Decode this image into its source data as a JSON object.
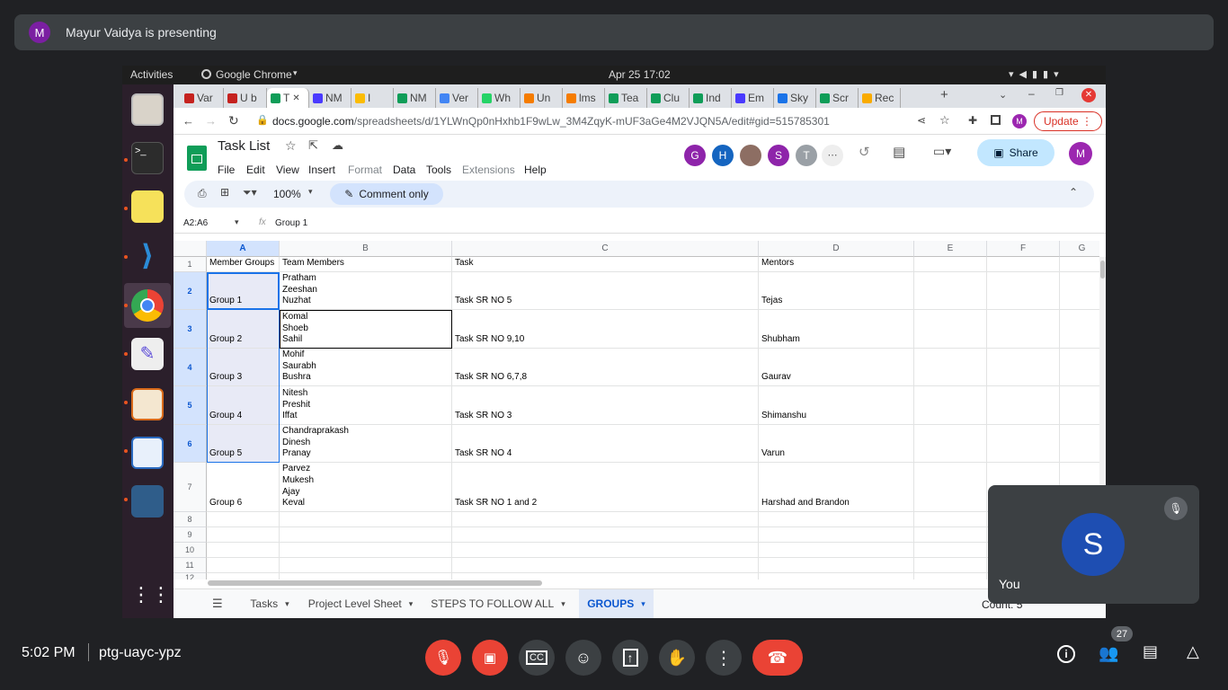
{
  "meet": {
    "presenter_initial": "M",
    "presenting_text": "Mayur Vaidya is presenting",
    "time": "5:02 PM",
    "meeting_code": "ptg-uayc-ypz",
    "participant_count": "27",
    "self_initial": "S",
    "self_label": "You"
  },
  "desktop": {
    "activities": "Activities",
    "app_name": "Google Chrome",
    "clock": "Apr 25  17:02"
  },
  "browser": {
    "tabs": [
      {
        "label": "Var",
        "color": "#c5221f"
      },
      {
        "label": "U b",
        "color": "#c5221f"
      },
      {
        "label": "T",
        "color": "#0f9d58",
        "active": true
      },
      {
        "label": "NM",
        "color": "#4a3aff"
      },
      {
        "label": "I",
        "color": "#fbbc04"
      },
      {
        "label": "NM",
        "color": "#0f9d58"
      },
      {
        "label": "Ver",
        "color": "#4285f4"
      },
      {
        "label": "Wh",
        "color": "#25d366"
      },
      {
        "label": "Un",
        "color": "#f57c00"
      },
      {
        "label": "lms",
        "color": "#f57c00"
      },
      {
        "label": "Tea",
        "color": "#0f9d58"
      },
      {
        "label": "Clu",
        "color": "#0f9d58"
      },
      {
        "label": "Ind",
        "color": "#0f9d58"
      },
      {
        "label": "Em",
        "color": "#4a3aff"
      },
      {
        "label": "Sky",
        "color": "#1a73e8"
      },
      {
        "label": "Scr",
        "color": "#0f9d58"
      },
      {
        "label": "Rec",
        "color": "#f9ab00"
      }
    ],
    "url_host": "docs.google.com",
    "url_path": "/spreadsheets/d/1YLWnQp0nHxhb1F9wLw_3M4ZqyK-mUF3aGe4M2VJQN5A/edit#gid=515785301",
    "update_label": "Update",
    "profile_initial": "M"
  },
  "sheets": {
    "doc_title": "Task List",
    "menus": [
      "File",
      "Edit",
      "View",
      "Insert",
      "Format",
      "Data",
      "Tools",
      "Extensions",
      "Help"
    ],
    "dim_menus": [
      "Format",
      "Extensions"
    ],
    "collaborators": [
      {
        "initial": "G",
        "color": "#8e24aa"
      },
      {
        "initial": "H",
        "color": "#1565c0"
      },
      {
        "initial": "",
        "color": "#8d6e63"
      },
      {
        "initial": "S",
        "color": "#8e24aa"
      },
      {
        "initial": "T",
        "color": "#9aa0a6"
      }
    ],
    "share_label": "Share",
    "account_initial": "M",
    "zoom": "100%",
    "mode_label": "Comment only",
    "name_box": "A2:A6",
    "formula": "Group 1",
    "columns": [
      "A",
      "B",
      "C",
      "D",
      "E",
      "F",
      "G"
    ],
    "rows": [
      {
        "num": "1",
        "cells": [
          "Member Groups",
          "Team Members",
          "Task",
          "Mentors"
        ]
      },
      {
        "num": "2",
        "cells": [
          "Group 1",
          "Pratham\nZeeshan\nNuzhat",
          "Task   SR NO 5",
          "Tejas"
        ]
      },
      {
        "num": "3",
        "cells": [
          "Group 2",
          "Komal\nShoeb\nSahil",
          "Task   SR NO 9,10",
          "Shubham"
        ]
      },
      {
        "num": "4",
        "cells": [
          "Group 3",
          "Mohif\nSaurabh\nBushra",
          "Task   SR NO 6,7,8",
          "Gaurav"
        ]
      },
      {
        "num": "5",
        "cells": [
          "Group 4",
          "Nitesh\nPreshit\nIffat",
          "Task   SR NO 3",
          "Shimanshu"
        ]
      },
      {
        "num": "6",
        "cells": [
          "Group 5",
          "Chandraprakash\nDinesh\nPranay",
          "Task   SR NO 4",
          "Varun"
        ]
      },
      {
        "num": "7",
        "cells": [
          "Group 6",
          "Parvez\nMukesh\nAjay\nKeval",
          "Task   SR NO 1 and 2",
          "Harshad and Brandon"
        ]
      },
      {
        "num": "8",
        "cells": [
          "",
          "",
          "",
          ""
        ]
      },
      {
        "num": "9",
        "cells": [
          "",
          "",
          "",
          ""
        ]
      },
      {
        "num": "10",
        "cells": [
          "",
          "",
          "",
          ""
        ]
      },
      {
        "num": "11",
        "cells": [
          "",
          "",
          "",
          ""
        ]
      },
      {
        "num": "12",
        "cells": [
          "",
          "",
          "",
          ""
        ]
      }
    ],
    "sheet_tabs": [
      {
        "label": "Tasks",
        "active": false
      },
      {
        "label": "Project Level Sheet",
        "active": false
      },
      {
        "label": "STEPS TO FOLLOW ALL",
        "active": false
      },
      {
        "label": "GROUPS",
        "active": true
      }
    ],
    "status": "Count: 5"
  }
}
